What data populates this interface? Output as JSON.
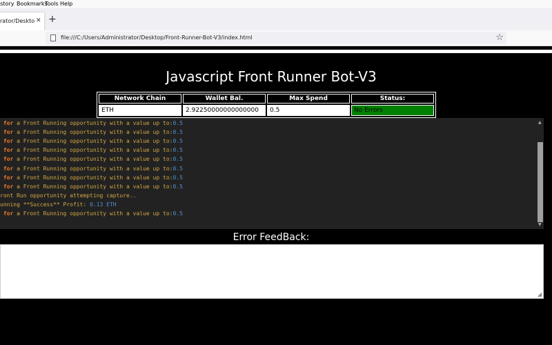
{
  "browser": {
    "menu": [
      "istory",
      "Bookmarks",
      "Tools",
      "Help"
    ],
    "tab_title": "rator/Desktop/F",
    "url": "file:///C:/Users/Administrator/Desktop/Front-Runner-Bot-V3/index.html"
  },
  "page": {
    "title": "Javascript Front Runner Bot-V3",
    "table": {
      "headers": [
        "Network Chain",
        "Wallet Bal.",
        "Max Spend",
        "Status:"
      ],
      "values": [
        "ETH",
        "2.92250000000000000",
        "0.5",
        "No Errors"
      ]
    },
    "console": [
      {
        "kw": " for",
        "text": " a Front Running opportunity with a value up to:",
        "num": "0.5"
      },
      {
        "kw": " for",
        "text": " a Front Running opportunity with a value up to:",
        "num": "0.5"
      },
      {
        "kw": " for",
        "text": " a Front Running opportunity with a value up to:",
        "num": "0.5"
      },
      {
        "kw": " for",
        "text": " a Front Running opportunity with a value up to:",
        "num": "0.5"
      },
      {
        "kw": " for",
        "text": " a Front Running opportunity with a value up to:",
        "num": "0.5"
      },
      {
        "kw": " for",
        "text": " a Front Running opportunity with a value up to:",
        "num": "0.5"
      },
      {
        "kw": " for",
        "text": " a Front Running opportunity with a value up to:",
        "num": "0.5"
      },
      {
        "kw": " for",
        "text": " a Front Running opportunity with a value up to:",
        "num": "0.5"
      },
      {
        "kw": "",
        "text": "ront Run opportunity attempting capture..",
        "num": ""
      },
      {
        "kw": "",
        "text": "unning **Success** Profit: ",
        "num": "0.13",
        "tail": " ETH"
      },
      {
        "kw": " for",
        "text": " a Front Running opportunity with a value up to:",
        "num": "0.5"
      }
    ],
    "error_title": "Error FeedBack:"
  },
  "colors": {
    "status_ok": "#008000",
    "console_bg": "#222222",
    "console_text": "#d4a843",
    "keyword": "#f07a2a",
    "number": "#4f8fd4"
  }
}
